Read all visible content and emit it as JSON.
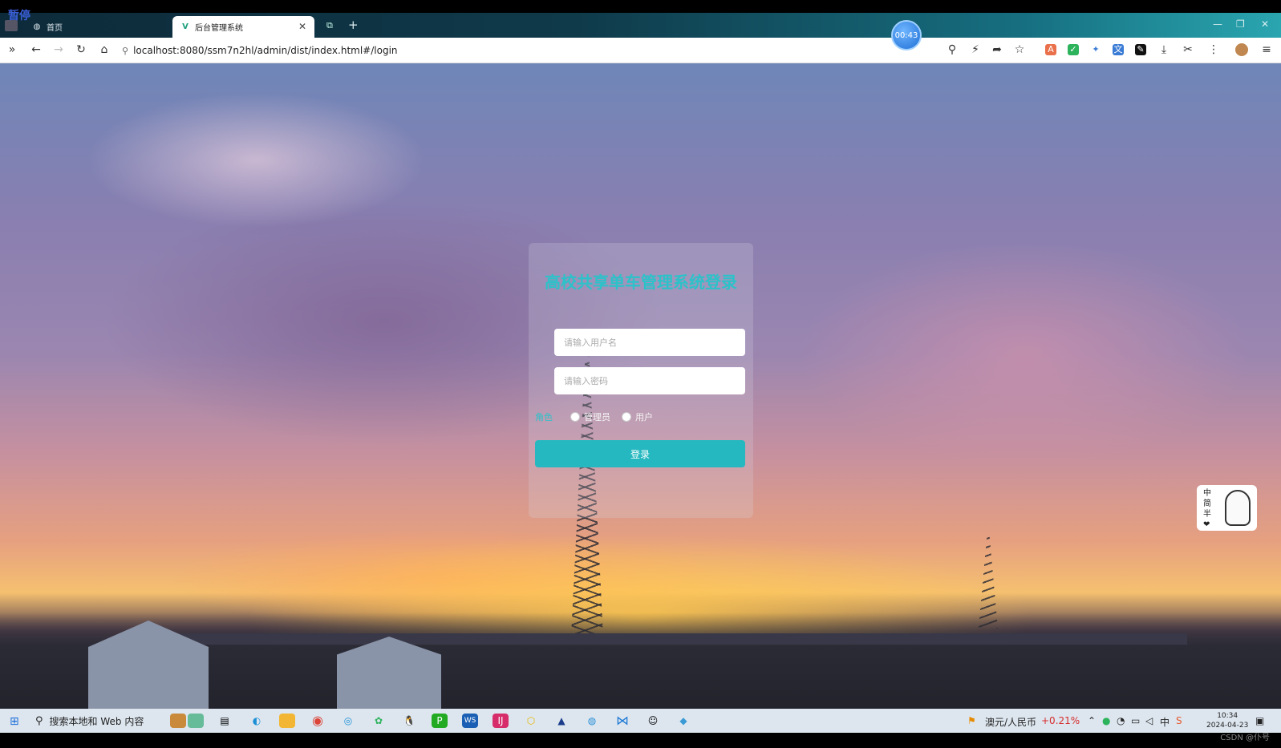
{
  "overlay": {
    "pause_label": "暂停",
    "timer": "00:43"
  },
  "browser": {
    "tabs": [
      {
        "label": "首页",
        "active": false
      },
      {
        "label": "后台管理系统",
        "active": true
      }
    ],
    "new_tab_symbol": "+",
    "url": "localhost:8080/ssm7n2hl/admin/dist/index.html#/login"
  },
  "login": {
    "title": "高校共享单车管理系统登录",
    "username_placeholder": "请输入用户名",
    "password_placeholder": "请输入密码",
    "password_side_label": "",
    "role_label": "角色",
    "roles": [
      "管理员",
      "用户"
    ],
    "submit_label": "登录",
    "accent_color": "#26b8c0"
  },
  "ime": {
    "chars": [
      "中",
      "简",
      "半",
      "❤"
    ]
  },
  "taskbar": {
    "search_text": "搜索本地和 Web 内容",
    "currency_label": "澳元/人民币",
    "currency_change": "+0.21%",
    "time": "10:34",
    "date": "2024-04-23"
  },
  "watermark": "CSDN @仆号"
}
